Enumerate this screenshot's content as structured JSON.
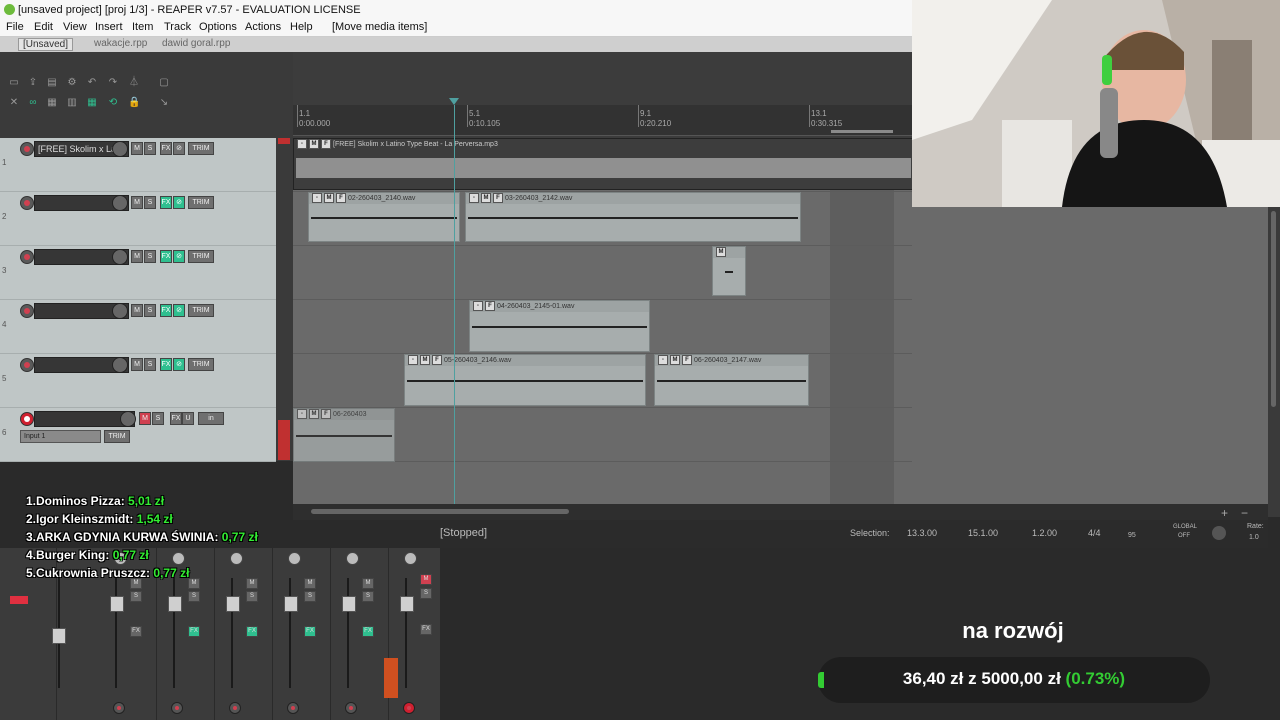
{
  "window": {
    "title": "[unsaved project] [proj 1/3] - REAPER v7.57 - EVALUATION LICENSE"
  },
  "menu": [
    "File",
    "Edit",
    "View",
    "Insert",
    "Item",
    "Track",
    "Options",
    "Actions",
    "Help",
    "[Move media items]"
  ],
  "project_tabs": [
    "[Unsaved]",
    "wakacje.rpp",
    "dawid goral.rpp"
  ],
  "ruler": {
    "bars": [
      "1.1",
      "5.1",
      "9.1",
      "13.1"
    ],
    "times": [
      "0:00.000",
      "0:10.105",
      "0:20.210",
      "0:30.315"
    ]
  },
  "tracks": [
    {
      "num": "1",
      "name": "[FREE] Skolim x La",
      "buttons": [
        "M",
        "S",
        "FX",
        "⊘",
        "TRIM"
      ],
      "armed": false,
      "fx_active": false
    },
    {
      "num": "2",
      "name": "",
      "buttons": [
        "M",
        "S",
        "FX",
        "⊘",
        "TRIM"
      ],
      "armed": false,
      "fx_active": true
    },
    {
      "num": "3",
      "name": "",
      "buttons": [
        "M",
        "S",
        "FX",
        "⊘",
        "TRIM"
      ],
      "armed": false,
      "fx_active": true
    },
    {
      "num": "4",
      "name": "",
      "buttons": [
        "M",
        "S",
        "FX",
        "⊘",
        "TRIM"
      ],
      "armed": false,
      "fx_active": true
    },
    {
      "num": "5",
      "name": "",
      "buttons": [
        "M",
        "S",
        "FX",
        "⊘",
        "TRIM"
      ],
      "armed": false,
      "fx_active": true
    },
    {
      "num": "6",
      "name": "",
      "buttons": [
        "M",
        "S",
        "FX",
        "U",
        "in"
      ],
      "armed": true,
      "fx_active": false,
      "input": "Input 1"
    }
  ],
  "items": [
    {
      "label": "[FREE] Skolim x Latino Type Beat - La Perversa.mp3"
    },
    {
      "label": "02-260403_2140.wav"
    },
    {
      "label": "03-260403_2142.wav"
    },
    {
      "label": "04-260403_2145-01.wav"
    },
    {
      "label": "05-260403_2146.wav"
    },
    {
      "label": "06-260403_2147.wav"
    },
    {
      "label": "06-260403"
    }
  ],
  "transport": {
    "status": "[Stopped]",
    "selection_label": "Selection:",
    "selection_start": "13.3.00",
    "selection_end": "15.1.00",
    "selection_length": "1.2.00",
    "time_sig": "4/4",
    "bpm": "95",
    "global": "GLOBAL",
    "global_state": "OFF",
    "rate_label": "Rate:",
    "rate_value": "1.0"
  },
  "leaderboard": [
    {
      "rank": "1.",
      "name": "Dominos Pizza:",
      "amount": "5,01 zł"
    },
    {
      "rank": "2.",
      "name": "Igor Kleinszmidt:",
      "amount": "1,54 zł"
    },
    {
      "rank": "3.",
      "name": "ARKA GDYNIA KURWA ŚWINIA:",
      "amount": "0,77 zł"
    },
    {
      "rank": "4.",
      "name": "Burger King:",
      "amount": "0,77 zł"
    },
    {
      "rank": "5.",
      "name": "Cukrownia Pruszcz:",
      "amount": "0,77 zł"
    }
  ],
  "goal": {
    "title": "na rozwój",
    "current": "36,40 zł",
    "z": "z",
    "target": "5000,00 zł",
    "percent": "(0.73%)",
    "progress_fraction": 0.0073
  },
  "colors": {
    "accent_green": "#33cc33",
    "fx_active": "#2fbf8f",
    "record_red": "#d04050",
    "play_cursor": "#4fa0a0"
  }
}
